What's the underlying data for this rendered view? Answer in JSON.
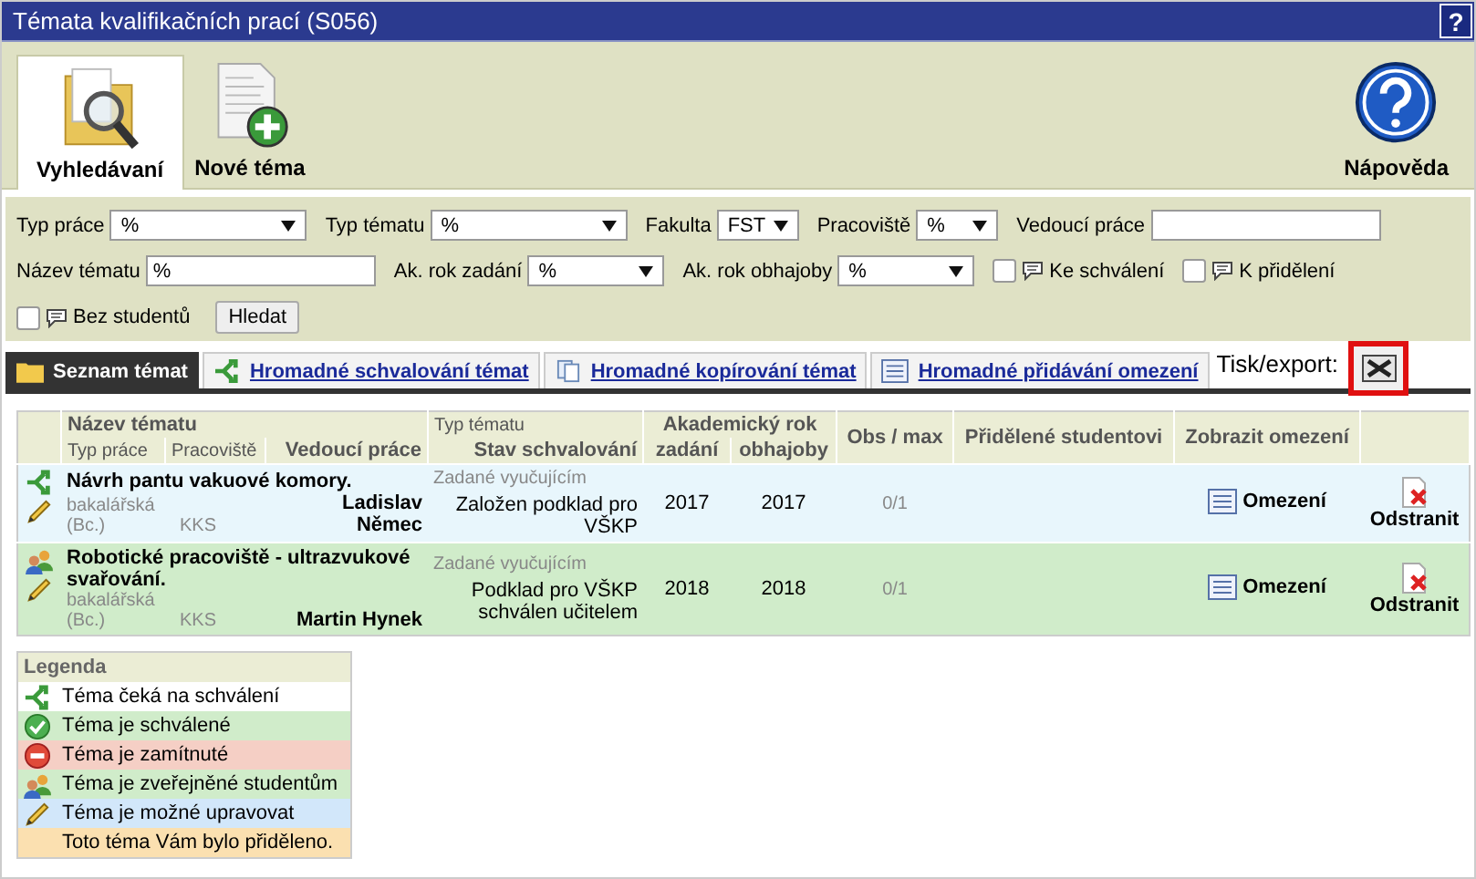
{
  "window": {
    "title": "Témata kvalifikačních prací (S056)",
    "help": "?"
  },
  "toolbar": [
    {
      "label": "Vyhledávaní",
      "kind": "search",
      "selected": true
    },
    {
      "label": "Nové téma",
      "kind": "new",
      "selected": false
    },
    {
      "label": "Nápověda",
      "kind": "help",
      "selected": false
    }
  ],
  "filters": [
    {
      "kind": "select",
      "label": "Typ práce",
      "value": "%"
    },
    {
      "kind": "select",
      "label": "Typ tématu",
      "value": "%"
    },
    {
      "kind": "select",
      "label": "Fakulta",
      "value": "FST"
    },
    {
      "kind": "select",
      "label": "Pracoviště",
      "value": "%"
    },
    {
      "kind": "text",
      "label": "Vedoucí práce"
    },
    {
      "kind": "text",
      "label": "Název tématu",
      "value": "%"
    },
    {
      "kind": "select",
      "label": "Ak. rok zadání",
      "value": "%"
    },
    {
      "kind": "select",
      "label": "Ak. rok obhajoby",
      "value": "%"
    },
    {
      "kind": "check",
      "label": "Ke schválení",
      "checked": false
    },
    {
      "kind": "check",
      "label": "K přidělení",
      "checked": false
    },
    {
      "kind": "check",
      "label": "Bez studentů",
      "checked": false
    },
    {
      "kind": "button",
      "label": "Hledat"
    }
  ],
  "tabs": [
    {
      "label": "Seznam témat",
      "kind": "folder",
      "selected": true
    },
    {
      "label": "Hromadné schvalování témat",
      "kind": "approve",
      "selected": false
    },
    {
      "label": "Hromadné kopírování témat",
      "kind": "copy",
      "selected": false
    },
    {
      "label": "Hromadné přidávání omezení",
      "kind": "list",
      "selected": false
    }
  ],
  "export": {
    "label": "Tisk/export:"
  },
  "table": {
    "header": {
      "name": "Název tématu",
      "type": "Typ práce",
      "dept": "Pracoviště",
      "supervisor": "Vedoucí práce",
      "topic_type": "Typ tématu",
      "status": "Stav schvalování",
      "year": "Akademický rok",
      "assigned": "zadání",
      "defense": "obhajoby",
      "obs": "Obs / max",
      "students": "Přidělené studentovi",
      "limits": "Zobrazit omezení"
    },
    "rows": [
      {
        "kind": "waiting",
        "editable": true,
        "color": "#e8f6fc",
        "name": "Návrh pantu vakuové komory.",
        "type": "bakalářská (Bc.)",
        "dept": "KKS",
        "supervisor": "Ladislav Němec",
        "topic_type": "Zadané vyučujícím",
        "status": "Založen podklad pro VŠKP",
        "assigned": "2017",
        "defense": "2017",
        "obs": "0/1",
        "limits": "Omezení",
        "remove": "Odstranit"
      },
      {
        "kind": "published",
        "editable": true,
        "color": "#d0ecca",
        "name": "Robotické pracoviště - ultrazvukové svařování.",
        "type": "bakalářská (Bc.)",
        "dept": "KKS",
        "supervisor": "Martin Hynek",
        "topic_type": "Zadané vyučujícím",
        "status": "Podklad pro VŠKP schválen učitelem",
        "assigned": "2018",
        "defense": "2018",
        "obs": "0/1",
        "limits": "Omezení",
        "remove": "Odstranit"
      }
    ]
  },
  "legend": {
    "title": "Legenda",
    "items": [
      {
        "kind": "waiting",
        "label": "Téma čeká na schválení",
        "color": "#ffffff"
      },
      {
        "kind": "approved",
        "label": "Téma je schválené",
        "color": "#d0ecca"
      },
      {
        "kind": "rejected",
        "label": "Téma je zamítnuté",
        "color": "#f5cfc5"
      },
      {
        "kind": "published",
        "label": "Téma je zveřejněné studentům",
        "color": "#d0ecca"
      },
      {
        "kind": "editable",
        "label": "Téma je možné upravovat",
        "color": "#d2e7fa"
      },
      {
        "kind": "none",
        "label": "Toto téma Vám bylo přiděleno.",
        "color": "#fbe0b0"
      }
    ]
  }
}
